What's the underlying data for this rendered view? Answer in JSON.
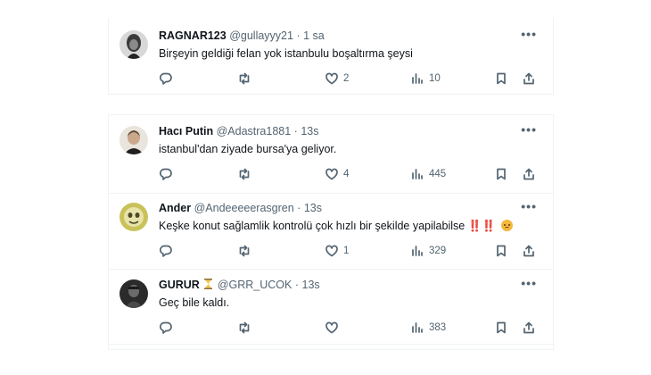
{
  "tweets": [
    {
      "name": "RAGNAR123",
      "handle": "@gullayyy21",
      "time": "1 sa",
      "text": "Birşeyin geldiği felan yok istanbulu boşaltırma şeysi",
      "replies": "",
      "retweets": "",
      "likes": "2",
      "views": "10"
    },
    {
      "name": "Hacı Putin",
      "handle": "@Adastra1881",
      "time": "13s",
      "text": "istanbul'dan ziyade bursa'ya geliyor.",
      "replies": "",
      "retweets": "",
      "likes": "4",
      "views": "445"
    },
    {
      "name": "Ander",
      "handle": "@Andeeeeerasgren",
      "time": "13s",
      "text": "Keşke konut sağlamlik kontrolü çok hızlı bir şekilde yapilabilse",
      "emphasis": "‼️‼️",
      "replies": "",
      "retweets": "",
      "likes": "1",
      "views": "329"
    },
    {
      "name": "GURUR",
      "handle": "@GRR_UCOK",
      "time": "13s",
      "text": "Geç bile kaldı.",
      "replies": "",
      "retweets": "",
      "likes": "",
      "views": "383"
    }
  ],
  "separator": "·",
  "more_label": "•••",
  "icons": {
    "reply": "reply-icon",
    "retweet": "retweet-icon",
    "like": "heart-icon",
    "views": "views-icon",
    "bookmark": "bookmark-icon",
    "share": "share-icon",
    "emoji": "disappointed-face-icon",
    "badge": "hourglass-icon"
  }
}
